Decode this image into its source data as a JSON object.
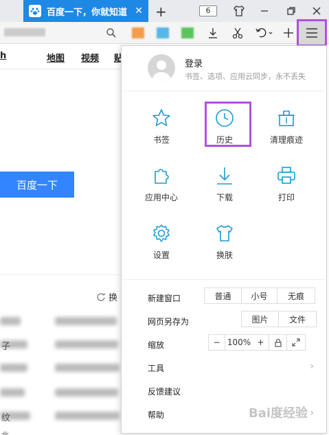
{
  "tab": {
    "title": "百度一下，你就知道",
    "count": "6"
  },
  "page": {
    "nav_links": [
      "h",
      "地图",
      "视频",
      "贴"
    ],
    "search_button": "百度一下",
    "refresh_label": "换",
    "blurred_left": [
      "子",
      "",
      "",
      "",
      "纹",
      "北"
    ]
  },
  "menu": {
    "login_title": "登录",
    "login_subtitle": "书签、选项、应用云同步，永不丢失",
    "grid": [
      {
        "label": "书签",
        "icon": "star-icon"
      },
      {
        "label": "历史",
        "icon": "clock-icon"
      },
      {
        "label": "清理痕迹",
        "icon": "trash-icon"
      },
      {
        "label": "应用中心",
        "icon": "puzzle-icon"
      },
      {
        "label": "下载",
        "icon": "download-icon"
      },
      {
        "label": "打印",
        "icon": "printer-icon"
      },
      {
        "label": "设置",
        "icon": "gear-icon"
      },
      {
        "label": "换肤",
        "icon": "tshirt-icon"
      }
    ],
    "new_window": {
      "label": "新建窗口",
      "options": [
        "普通",
        "小号",
        "无痕"
      ]
    },
    "save_as": {
      "label": "网页另存为",
      "options": [
        "图片",
        "文件"
      ]
    },
    "zoom": {
      "label": "缩放",
      "minus": "−",
      "value": "100%",
      "plus": "+"
    },
    "tools": "工具",
    "feedback": "反馈建议",
    "help": "帮助"
  },
  "watermark": "Bai度经验",
  "colors": {
    "accent": "#1e88e5",
    "highlight": "#b14fe0",
    "icon": "#1a9ad6",
    "baidu_blue": "#3385ff"
  }
}
